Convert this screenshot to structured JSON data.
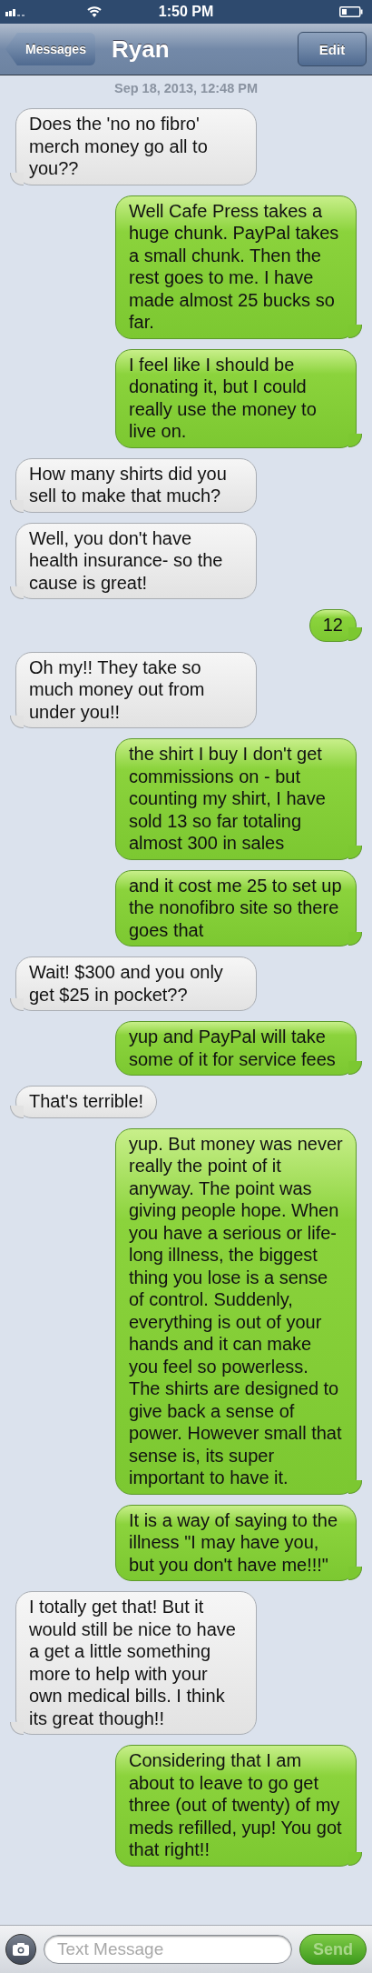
{
  "status_bar": {
    "time": "1:50 PM"
  },
  "nav": {
    "back": "Messages",
    "title": "Ryan",
    "action": "Edit"
  },
  "timestamp": "Sep 18, 2013, 12:48 PM",
  "messages": [
    {
      "kind": "received",
      "text": "Does the 'no no fibro' merch money go all to you??"
    },
    {
      "kind": "sent",
      "text": "Well Cafe Press takes a huge chunk. PayPal takes a small chunk. Then the rest goes to me. I have made almost 25 bucks so far."
    },
    {
      "kind": "sent",
      "text": "I feel like I should be donating it, but I could really use the money to live on."
    },
    {
      "kind": "received",
      "text": "How many shirts did you sell to make that much?"
    },
    {
      "kind": "received",
      "text": "Well, you don't have health insurance- so the cause is great!"
    },
    {
      "kind": "sent",
      "text": "12"
    },
    {
      "kind": "received",
      "text": "Oh my!! They take so much money out from under you!!"
    },
    {
      "kind": "sent",
      "text": "the shirt I buy I don't get commissions on - but counting my shirt, I have sold 13 so far totaling almost 300 in sales"
    },
    {
      "kind": "sent",
      "text": "and it cost me 25 to set up the nonofibro site so there goes that"
    },
    {
      "kind": "received",
      "text": "Wait! $300 and you only get $25 in pocket??"
    },
    {
      "kind": "sent",
      "text": "yup and PayPal will take some of it for service fees"
    },
    {
      "kind": "received",
      "text": "That's terrible!"
    },
    {
      "kind": "sent",
      "text": "yup. But money was never really the point of it anyway. The point was giving people hope. When you have a serious or life-long illness, the biggest thing you lose is a sense of control. Suddenly, everything is out of your hands and it can make you feel so powerless. The shirts are designed to give back a sense of power. However small that sense is, its super important to have it."
    },
    {
      "kind": "sent",
      "text": "It is a way of saying to the illness \"I may have you, but you don't have me!!!\""
    },
    {
      "kind": "received",
      "text": "I totally get that! But it would still be nice to have a get a little something more to help with your own medical bills. I think its great though!!"
    },
    {
      "kind": "sent",
      "text": "Considering that I am about to leave to go get three (out of twenty) of my meds refilled, yup! You got that right!!"
    }
  ],
  "compose": {
    "placeholder": "Text Message",
    "send": "Send",
    "send_disabled": true
  }
}
